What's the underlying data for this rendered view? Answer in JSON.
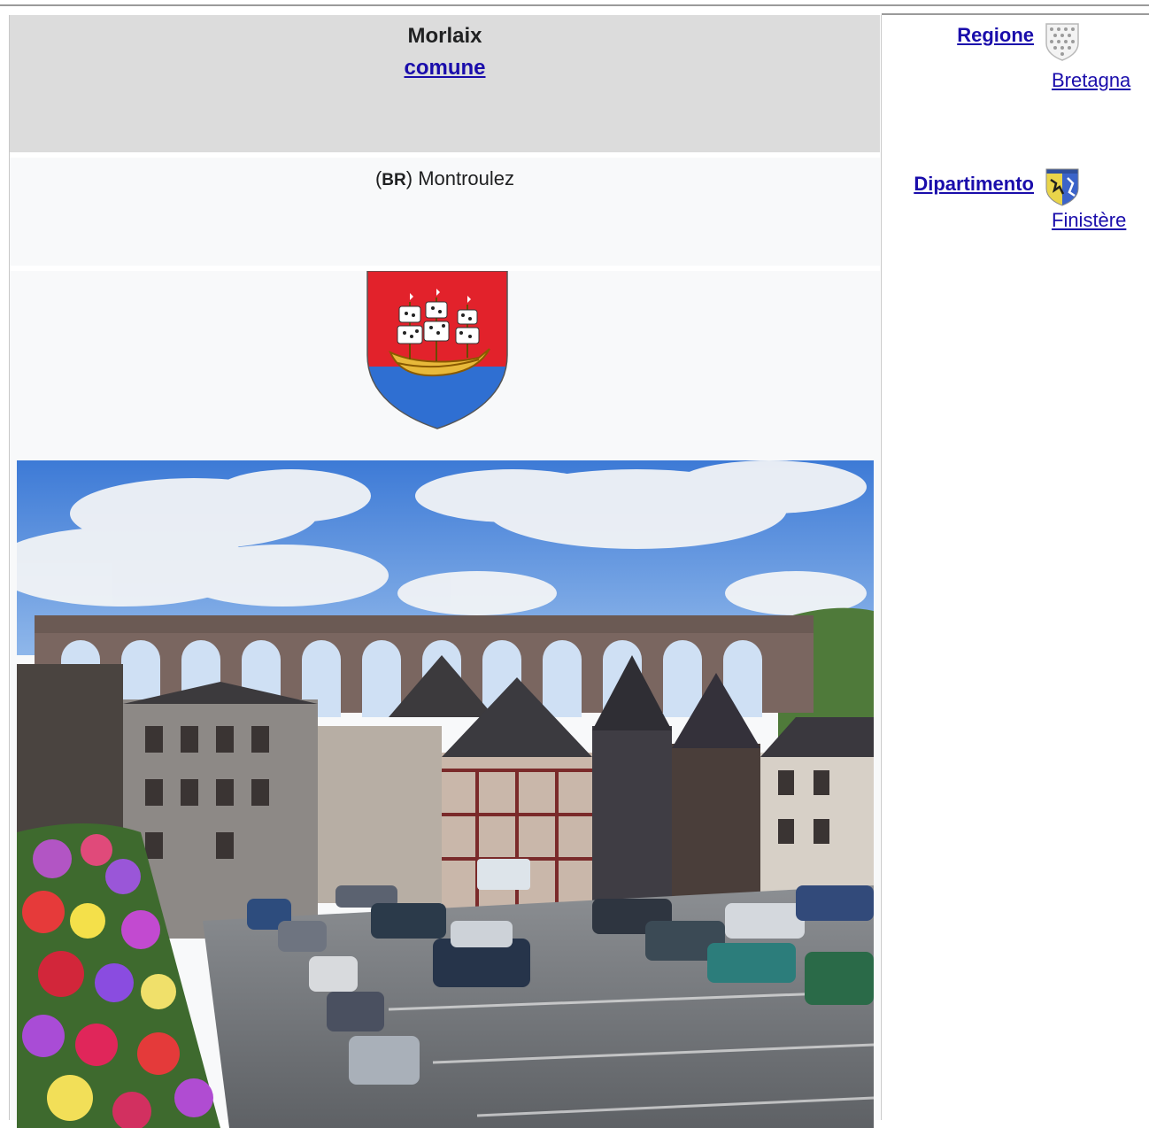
{
  "infobox": {
    "title": "Morlaix",
    "type_link": "comune",
    "local_name": {
      "lang_code": "BR",
      "name": "Montroulez"
    }
  },
  "sidebar": {
    "rows": [
      {
        "label": "Regione",
        "value": "Bretagna",
        "icon": "gothic-shield-icon"
      },
      {
        "label": "Dipartimento",
        "value": "Finistère",
        "icon": "department-shield-icon"
      }
    ]
  },
  "colors": {
    "link": "#1a0dab",
    "header_bg": "#dcdcdc",
    "cell_bg": "#f8f9fa",
    "coa_red": "#e2222b",
    "coa_blue": "#2f6fd2",
    "coa_gold": "#e8b93a"
  }
}
